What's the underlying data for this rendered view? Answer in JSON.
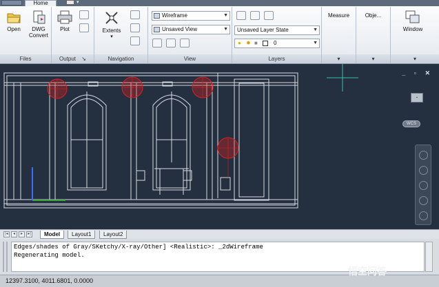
{
  "ribbon": {
    "home_tab": "Home",
    "files": {
      "open": "Open",
      "dwg_convert_line1": "DWG",
      "dwg_convert_line2": "Convert",
      "title": "Files"
    },
    "output": {
      "plot": "Plot",
      "title": "Output",
      "launcher": "↘"
    },
    "navigation": {
      "extents": "Extents",
      "title": "Navigation"
    },
    "view": {
      "visual_style": "Wireframe",
      "named_view": "Unsaved View",
      "title": "View"
    },
    "layers": {
      "layer_state": "Unsaved Layer State",
      "current_layer": "0",
      "title": "Layers"
    },
    "measure": "Measure",
    "objects": "Obje...",
    "window": "Window"
  },
  "layout_tabs": [
    "Model",
    "Layout1",
    "Layout2"
  ],
  "command": {
    "line1": "Edges/shades of Gray/SKetchy/X-ray/Other] <Realistic>: _2dWireframe",
    "line2": "Regenerating model."
  },
  "status": {
    "coordinates": "12397.3100, 4011.6801, 0.0000"
  },
  "viewcube": {
    "label": "WCS"
  },
  "watermark": "悟空问答",
  "colors": {
    "drawing_bg": "#243040",
    "hatch_red": "#e02020",
    "ucs_z": "#3a6cff",
    "ucs_x": "#3aa53a"
  }
}
